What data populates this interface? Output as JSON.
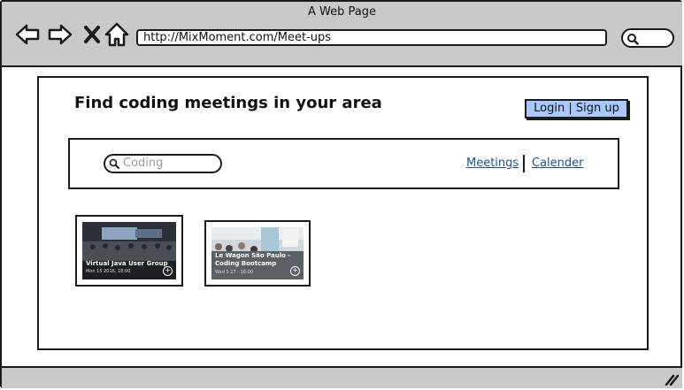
{
  "window": {
    "title": "A Web Page"
  },
  "browser": {
    "url": "http://MixMoment.com/Meet-ups",
    "icons": [
      "back-arrow-icon",
      "forward-arrow-icon",
      "close-x-icon",
      "home-icon",
      "search-icon"
    ]
  },
  "page": {
    "title": "Find coding meetings in your area",
    "login_label": "Login | Sign up",
    "search": {
      "placeholder": "Coding"
    },
    "nav": {
      "meetings": "Meetings",
      "calendar": "Calender"
    },
    "cards": [
      {
        "name": "Virtual Java User Group",
        "date": "Mon 15 2016, 18:00"
      },
      {
        "name": "Le Wagon São Paulo - Coding Bootcamp",
        "date": "Wed 5 27 - 18:00"
      }
    ]
  },
  "colors": {
    "chrome": "#c9c9c9",
    "login_button": "#a8c8ff",
    "link": "#1f4f8f"
  }
}
